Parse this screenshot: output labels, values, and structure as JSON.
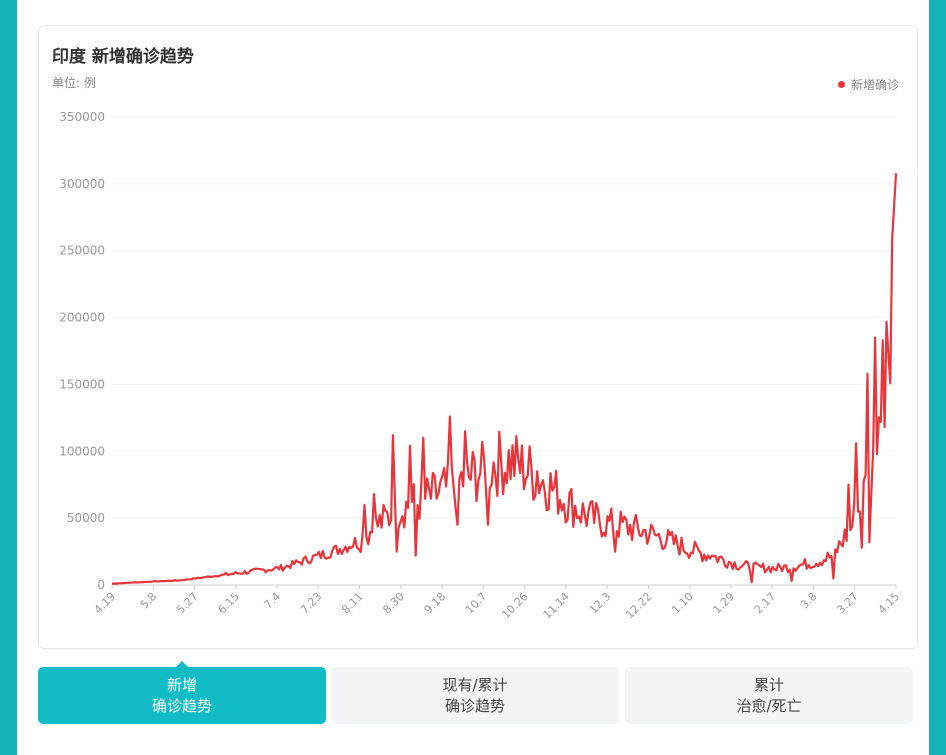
{
  "card": {
    "title": "印度 新增确诊趋势",
    "unit": "单位: 例"
  },
  "chart_data": {
    "type": "line",
    "title": "印度 新增确诊趋势",
    "ylabel": "单位: 例",
    "ylim": [
      0,
      350000
    ],
    "yticks": [
      0,
      50000,
      100000,
      150000,
      200000,
      250000,
      300000,
      350000
    ],
    "xticks": [
      "4.19",
      "5.8",
      "5.27",
      "6.15",
      "7.4",
      "7.23",
      "8.11",
      "8.30",
      "9.18",
      "10.7",
      "10.26",
      "11.14",
      "12.3",
      "12.22",
      "1.10",
      "1.29",
      "2.17",
      "3.8",
      "3.27",
      "4.15"
    ],
    "legend_position": "top-right",
    "grid": true,
    "color": "#e8353b",
    "series": [
      {
        "name": "新增确诊",
        "anchors": [
          [
            0,
            1000
          ],
          [
            20,
            2500
          ],
          [
            36,
            3500
          ],
          [
            50,
            6000
          ],
          [
            70,
            9500
          ],
          [
            90,
            13000
          ],
          [
            105,
            20000
          ],
          [
            120,
            27000
          ],
          [
            130,
            33000
          ],
          [
            140,
            45000
          ],
          [
            150,
            56000
          ],
          [
            160,
            62000
          ],
          [
            170,
            67000
          ],
          [
            180,
            75000
          ],
          [
            190,
            82000
          ],
          [
            200,
            90000
          ],
          [
            210,
            93000
          ],
          [
            220,
            85000
          ],
          [
            230,
            75000
          ],
          [
            240,
            62000
          ],
          [
            250,
            52000
          ],
          [
            260,
            46000
          ],
          [
            270,
            44000
          ],
          [
            280,
            40000
          ],
          [
            290,
            35000
          ],
          [
            300,
            29000
          ],
          [
            310,
            24000
          ],
          [
            320,
            20000
          ],
          [
            330,
            15000
          ],
          [
            340,
            13000
          ],
          [
            350,
            12500
          ],
          [
            360,
            14000
          ],
          [
            370,
            17000
          ],
          [
            380,
            22000
          ],
          [
            390,
            45000
          ],
          [
            396,
            65000
          ],
          [
            400,
            95000
          ],
          [
            404,
            135000
          ],
          [
            408,
            170000
          ],
          [
            410,
            225000
          ],
          [
            412,
            295000
          ],
          [
            413,
            308000
          ]
        ],
        "spikes": [
          [
            133,
            60000
          ],
          [
            138,
            68000
          ],
          [
            148,
            112000
          ],
          [
            150,
            25000
          ],
          [
            157,
            104000
          ],
          [
            160,
            22000
          ],
          [
            164,
            110000
          ],
          [
            178,
            126000
          ],
          [
            182,
            45000
          ],
          [
            186,
            115000
          ],
          [
            195,
            107000
          ],
          [
            198,
            45000
          ],
          [
            207,
            84000
          ],
          [
            224,
            85000
          ],
          [
            265,
            25000
          ],
          [
            316,
            22000
          ],
          [
            337,
            2000
          ],
          [
            358,
            3000
          ],
          [
            380,
            5000
          ],
          [
            388,
            75000
          ],
          [
            392,
            106000
          ],
          [
            395,
            28000
          ],
          [
            398,
            158000
          ],
          [
            399,
            32000
          ],
          [
            402,
            185000
          ],
          [
            403,
            98000
          ],
          [
            406,
            183000
          ],
          [
            407,
            118000
          ]
        ]
      }
    ]
  },
  "tabs": [
    {
      "line1": "新增",
      "line2": "确诊趋势"
    },
    {
      "line1": "现有/累计",
      "line2": "确诊趋势"
    },
    {
      "line1": "累计",
      "line2": "治愈/死亡"
    }
  ]
}
